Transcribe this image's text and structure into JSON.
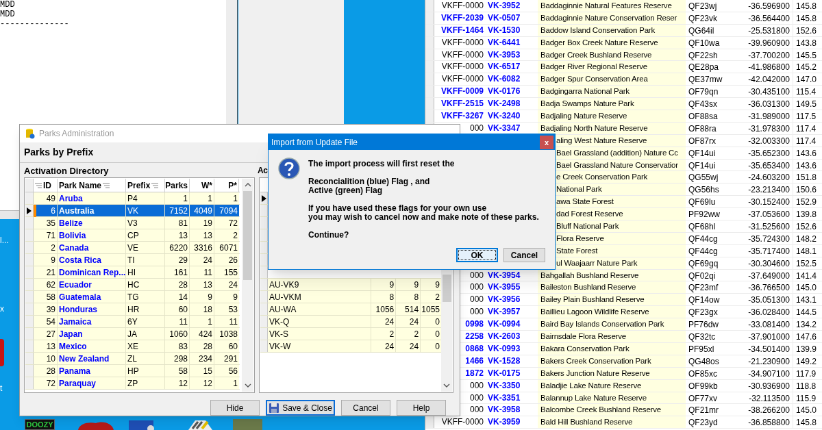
{
  "editor": {
    "lines": [
      "MDD",
      "MDD",
      "--------------"
    ]
  },
  "desktop": {
    "side_labels": [
      "l...",
      "x",
      "t"
    ],
    "dock_label": "DOOZY"
  },
  "park_list": {
    "rows": [
      {
        "vkff": "VKFF-0000",
        "assigned": false,
        "vk": "VK-3952",
        "name": "Baddaginnie Natural Features Reserve",
        "locator": "QF23wj",
        "lat": "-36.596900",
        "lon": "145.8"
      },
      {
        "vkff": "VKFF-2039",
        "assigned": true,
        "vk": "VK-0507",
        "name": "Baddaginnie Nature Conservation Reser",
        "locator": "QF23vk",
        "lat": "-36.564400",
        "lon": "145.8"
      },
      {
        "vkff": "VKFF-1464",
        "assigned": true,
        "vk": "VK-1530",
        "name": "Baddow Island Conservation Park",
        "locator": "QG64il",
        "lat": "-25.531800",
        "lon": "152.6"
      },
      {
        "vkff": "VKFF-0000",
        "assigned": false,
        "vk": "VK-6441",
        "name": "Badger Box Creek Nature Reserve",
        "locator": "QF10wa",
        "lat": "-39.960900",
        "lon": "143.8"
      },
      {
        "vkff": "VKFF-0000",
        "assigned": false,
        "vk": "VK-3953",
        "name": "Badger Creek Bushland Reserve",
        "locator": "QF22sh",
        "lat": "-37.700200",
        "lon": "145.5"
      },
      {
        "vkff": "VKFF-0000",
        "assigned": false,
        "vk": "VK-6517",
        "name": "Badger River Regional Reserve",
        "locator": "QE28pa",
        "lat": "-41.986800",
        "lon": "145.2"
      },
      {
        "vkff": "VKFF-0000",
        "assigned": false,
        "vk": "VK-6082",
        "name": "Badger Spur Conservation Area",
        "locator": "QE37mw",
        "lat": "-42.042000",
        "lon": "147.0"
      },
      {
        "vkff": "VKFF-0009",
        "assigned": true,
        "vk": "VK-0176",
        "name": "Badgingarra National Park",
        "locator": "OF79qn",
        "lat": "-30.435100",
        "lon": "115.4"
      },
      {
        "vkff": "VKFF-2515",
        "assigned": true,
        "vk": "VK-2498",
        "name": "Badja Swamps Nature Park",
        "locator": "QF43sx",
        "lat": "-36.031300",
        "lon": "149.5"
      },
      {
        "vkff": "VKFF-3267",
        "assigned": true,
        "vk": "VK-3240",
        "name": "Badjaling Nature Reserve",
        "locator": "OF88sa",
        "lat": "-31.989000",
        "lon": "117.5"
      },
      {
        "vkff": "000",
        "assigned": false,
        "vk": "VK-3347",
        "name": "Badjaling North Nature Reserve",
        "locator": "OF88ra",
        "lat": "-31.978300",
        "lon": "117.4"
      },
      {
        "name": "aling West Nature Reserve",
        "locator": "OF87rx",
        "lat": "-32.003300",
        "lon": "117.4"
      },
      {
        "name": "Bael Grassland (addition) Nature Cc",
        "locator": "QF14ui",
        "lat": "-35.652300",
        "lon": "143.6"
      },
      {
        "name": "Bael Grassland Nature Conservatior",
        "locator": "QF14ui",
        "lat": "-35.653400",
        "lon": "143.6"
      },
      {
        "name": "e Creek Conservation Park",
        "locator": "QG55wj",
        "lat": "-24.603200",
        "lon": "151.8"
      },
      {
        "name": "National Park",
        "locator": "QG56hs",
        "lat": "-23.213400",
        "lon": "150.6"
      },
      {
        "name": "awa State Forest",
        "locator": "QF69lu",
        "lat": "-30.152400",
        "lon": "152.9"
      },
      {
        "name": "dad Forest Reserve",
        "locator": "PF92ww",
        "lat": "-37.053600",
        "lon": "139.8"
      },
      {
        "name": "Bluff National Park",
        "locator": "QF68hl",
        "lat": "-31.525600",
        "lon": "152.6"
      },
      {
        "name": "Flora Reserve",
        "locator": "QF44cg",
        "lat": "-35.724300",
        "lon": "148.2"
      },
      {
        "name": "State Forest",
        "locator": "QF44cg",
        "lat": "-35.717400",
        "lon": "148.1"
      },
      {
        "name": "ul Waajaarr Nature Park",
        "locator": "QF69gq",
        "lat": "-30.304600",
        "lon": "152.5"
      },
      {
        "vkff": "000",
        "assigned": false,
        "vk": "VK-3954",
        "name": "Bahgallah Bushland Reserve",
        "locator": "QF02qi",
        "lat": "-37.649000",
        "lon": "141.4"
      },
      {
        "vkff": "000",
        "assigned": false,
        "vk": "VK-3955",
        "name": "Baileston Bushland Reserve",
        "locator": "QF23mf",
        "lat": "-36.766500",
        "lon": "145.0"
      },
      {
        "vkff": "000",
        "assigned": false,
        "vk": "VK-3956",
        "name": "Bailey Plain Bushland Reserve",
        "locator": "QF14ow",
        "lat": "-35.051300",
        "lon": "143.1"
      },
      {
        "vkff": "000",
        "assigned": false,
        "vk": "VK-3957",
        "name": "Baillieu Lagoon Wildlife Reserve",
        "locator": "QF23gx",
        "lat": "-36.028400",
        "lon": "144.5"
      },
      {
        "vkff": "0998",
        "assigned": true,
        "vk": "VK-0994",
        "name": "Baird Bay Islands Conservation Park",
        "locator": "PF76dw",
        "lat": "-33.081400",
        "lon": "134.2"
      },
      {
        "vkff": "2258",
        "assigned": true,
        "vk": "VK-2603",
        "name": "Bairnsdale Flora Reserve",
        "locator": "QF32tc",
        "lat": "-37.901000",
        "lon": "147.6"
      },
      {
        "vkff": "0868",
        "assigned": true,
        "vk": "VK-0993",
        "name": "Bakara Conservation Park",
        "locator": "PF95xl",
        "lat": "-34.501400",
        "lon": "139.9"
      },
      {
        "vkff": "1466",
        "assigned": true,
        "vk": "VK-1528",
        "name": "Bakers Creek Conservation Park",
        "locator": "QG48os",
        "lat": "-21.230900",
        "lon": "149.2"
      },
      {
        "vkff": "1872",
        "assigned": true,
        "vk": "VK-0175",
        "name": "Bakers Junction Nature Reserve",
        "locator": "OF85xc",
        "lat": "-34.907100",
        "lon": "117.9"
      },
      {
        "vkff": "000",
        "assigned": false,
        "vk": "VK-3350",
        "name": "Baladjie Lake Nature Reserve",
        "locator": "OF99kb",
        "lat": "-30.936900",
        "lon": "118.8"
      },
      {
        "vkff": "000",
        "assigned": false,
        "vk": "VK-3351",
        "name": "Balannup Lake Nature Reserve",
        "locator": "OF77xv",
        "lat": "-32.113500",
        "lon": "115.9"
      },
      {
        "vkff": "000",
        "assigned": false,
        "vk": "VK-3958",
        "name": "Balcombe Creek Bushland Reserve",
        "locator": "QF21mr",
        "lat": "-38.266200",
        "lon": "145.0"
      },
      {
        "vkff": "VKFF-0000",
        "assigned": false,
        "vk": "VK-3959",
        "name": "Bald Hill Bushland Reserve",
        "locator": "QF23yd",
        "lat": "-36.858800",
        "lon": "145.8"
      }
    ]
  },
  "parks_window": {
    "title": "Parks Administration",
    "subtitle": "Parks by Prefix",
    "directory": {
      "heading": "Activation Directory",
      "columns": [
        "ID",
        "Park Name",
        "Prefix",
        "Parks",
        "W*",
        "P*"
      ],
      "rows": [
        {
          "id": "49",
          "name": "Aruba",
          "prefix": "P4",
          "parks": "1",
          "w": "1",
          "p": "1",
          "selected": false
        },
        {
          "id": "6",
          "name": "Australia",
          "prefix": "VK",
          "parks": "7152",
          "w": "4049",
          "p": "7094",
          "selected": true
        },
        {
          "id": "35",
          "name": "Belize",
          "prefix": "V3",
          "parks": "81",
          "w": "19",
          "p": "72",
          "selected": false
        },
        {
          "id": "71",
          "name": "Bolivia",
          "prefix": "CP",
          "parks": "13",
          "w": "13",
          "p": "2",
          "selected": false
        },
        {
          "id": "2",
          "name": "Canada",
          "prefix": "VE",
          "parks": "6220",
          "w": "3316",
          "p": "6071",
          "selected": false
        },
        {
          "id": "9",
          "name": "Costa Rica",
          "prefix": "TI",
          "parks": "29",
          "w": "24",
          "p": "26",
          "selected": false
        },
        {
          "id": "21",
          "name": "Dominican Rep...",
          "prefix": "HI",
          "parks": "161",
          "w": "11",
          "p": "155",
          "selected": false
        },
        {
          "id": "62",
          "name": "Ecuador",
          "prefix": "HC",
          "parks": "28",
          "w": "13",
          "p": "24",
          "selected": false
        },
        {
          "id": "58",
          "name": "Guatemala",
          "prefix": "TG",
          "parks": "14",
          "w": "9",
          "p": "9",
          "selected": false
        },
        {
          "id": "39",
          "name": "Honduras",
          "prefix": "HR",
          "parks": "60",
          "w": "18",
          "p": "53",
          "selected": false
        },
        {
          "id": "54",
          "name": "Jamaica",
          "prefix": "6Y",
          "parks": "11",
          "w": "1",
          "p": "11",
          "selected": false
        },
        {
          "id": "27",
          "name": "Japan",
          "prefix": "JA",
          "parks": "1060",
          "w": "424",
          "p": "1038",
          "selected": false
        },
        {
          "id": "13",
          "name": "Mexico",
          "prefix": "XE",
          "parks": "83",
          "w": "28",
          "p": "60",
          "selected": false
        },
        {
          "id": "10",
          "name": "New Zealand",
          "prefix": "ZL",
          "parks": "298",
          "w": "234",
          "p": "291",
          "selected": false
        },
        {
          "id": "28",
          "name": "Panama",
          "prefix": "HP",
          "parks": "58",
          "w": "15",
          "p": "56",
          "selected": false
        },
        {
          "id": "72",
          "name": "Paraquay",
          "prefix": "ZP",
          "parks": "12",
          "w": "12",
          "p": "1",
          "selected": false
        }
      ]
    },
    "areas": {
      "heading": "Ac",
      "rows": [
        {
          "selected": true
        },
        {
          "selected": false
        },
        {
          "selected": false
        },
        {
          "selected": false
        },
        {
          "selected": false
        },
        {
          "selected": false
        },
        {
          "selected": false
        },
        {
          "name": "AU-VK9",
          "c2": "9",
          "c3": "9",
          "c4": "9",
          "selected": false
        },
        {
          "name": "AU-VKM",
          "c2": "8",
          "c3": "8",
          "c4": "2",
          "selected": false
        },
        {
          "name": "AU-WA",
          "c2": "1056",
          "c3": "514",
          "c4": "1055",
          "selected": false
        },
        {
          "name": "VK-Q",
          "c2": "24",
          "c3": "24",
          "c4": "0",
          "selected": false
        },
        {
          "name": "VK-S",
          "c2": "2",
          "c3": "2",
          "c4": "0",
          "selected": false
        },
        {
          "name": "VK-W",
          "c2": "24",
          "c3": "24",
          "c4": "0",
          "selected": false
        }
      ]
    },
    "buttons": [
      {
        "label": "Hide",
        "kind": "plain"
      },
      {
        "label": "Save & Close",
        "kind": "save"
      },
      {
        "label": "Cancel",
        "kind": "plain"
      },
      {
        "label": "Help",
        "kind": "plain"
      }
    ]
  },
  "dialog": {
    "title": "Import from Update File",
    "close": "x",
    "paragraphs": [
      [
        "The import process will first reset the"
      ],
      [
        "Reconcialition (blue) Flag , and",
        "Active (green) Flag"
      ],
      [
        "If you have used these flags for your own use",
        "you may wish to cancel now and make note of these parks."
      ],
      [
        "Continue?"
      ]
    ],
    "buttons": [
      {
        "label": "OK",
        "default": true
      },
      {
        "label": "Cancel",
        "default": false
      }
    ]
  }
}
